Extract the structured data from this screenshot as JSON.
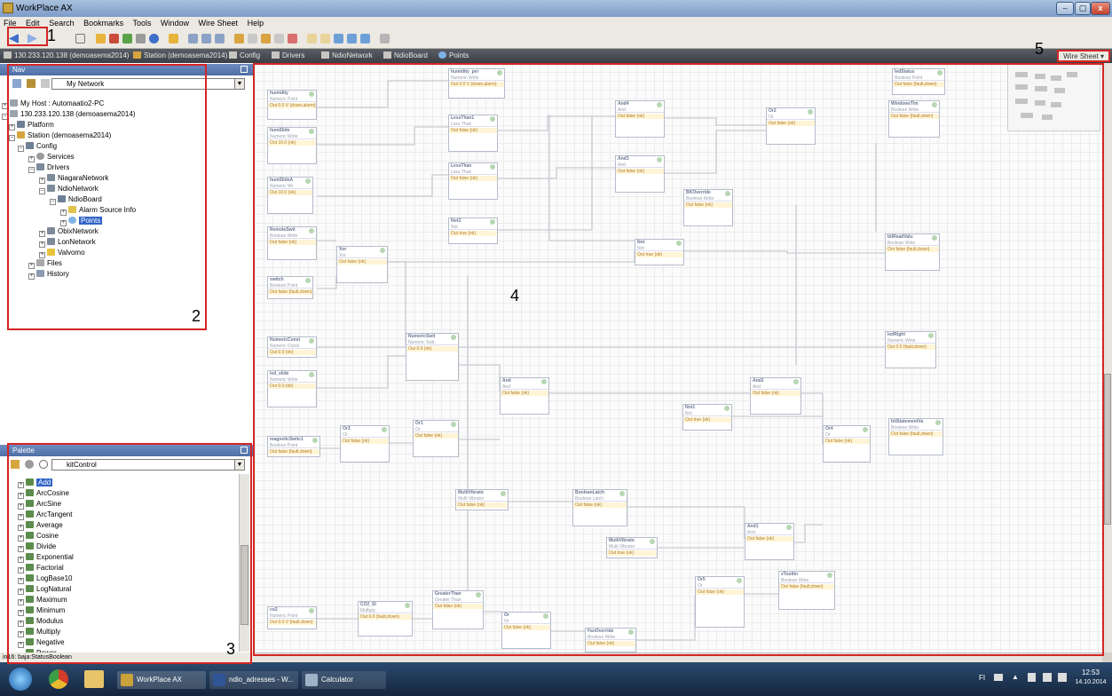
{
  "window": {
    "title": "WorkPlace AX",
    "min": "–",
    "max": "▢",
    "close": "x"
  },
  "menu": [
    "File",
    "Edit",
    "Search",
    "Bookmarks",
    "Tools",
    "Window",
    "Wire Sheet",
    "Help"
  ],
  "breadcrumb": [
    {
      "label": "130.233.120.138 (demoasema2014)",
      "icon": "host-icon"
    },
    {
      "label": "Station (demoasema2014)",
      "icon": "station-icon"
    },
    {
      "label": "Config",
      "icon": "config-icon"
    },
    {
      "label": "Drivers",
      "icon": "drivers-icon"
    },
    {
      "label": "NdioNetwork",
      "icon": "network-icon"
    },
    {
      "label": "NdioBoard",
      "icon": "board-icon"
    },
    {
      "label": "Points",
      "icon": "points-icon"
    }
  ],
  "view_selector": "Wire Sheet",
  "nav": {
    "title": "Nav",
    "selector": "My Network",
    "tree": [
      {
        "label": "My Host : Automaatio2-PC",
        "depth": 0
      },
      {
        "label": "130.233.120.138 (demoasema2014)",
        "depth": 0
      },
      {
        "label": "Platform",
        "depth": 1
      },
      {
        "label": "Station (demoasema2014)",
        "depth": 1
      },
      {
        "label": "Config",
        "depth": 2
      },
      {
        "label": "Services",
        "depth": 3
      },
      {
        "label": "Drivers",
        "depth": 3
      },
      {
        "label": "NiagaraNetwork",
        "depth": 4
      },
      {
        "label": "NdioNetwork",
        "depth": 4
      },
      {
        "label": "NdioBoard",
        "depth": 5
      },
      {
        "label": "Alarm Source Info",
        "depth": 6
      },
      {
        "label": "Points",
        "depth": 6,
        "selected": true
      },
      {
        "label": "ObixNetwork",
        "depth": 4
      },
      {
        "label": "LonNetwork",
        "depth": 4
      },
      {
        "label": "Valvomo",
        "depth": 4
      },
      {
        "label": "Files",
        "depth": 2
      },
      {
        "label": "History",
        "depth": 2
      }
    ]
  },
  "palette": {
    "title": "Palette",
    "selector": "kitControl",
    "items": [
      "Add",
      "ArcCosine",
      "ArcSine",
      "ArcTangent",
      "Average",
      "Cosine",
      "Divide",
      "Exponential",
      "Factorial",
      "LogBase10",
      "LogNatural",
      "Maximum",
      "Minimum",
      "Modulus",
      "Multiply",
      "Negative",
      "Power"
    ],
    "selected": "Add"
  },
  "status": "in16: baja:StatusBoolean",
  "callouts": [
    "1",
    "2",
    "3",
    "4",
    "5"
  ],
  "blocks": [
    {
      "name": "humidity",
      "type": "Numeric Point",
      "out": "Out 0.0 V {down,alarm}"
    },
    {
      "name": "humidity_per",
      "type": "Numeric Write",
      "out": "Out 0.0 V {down,alarm}"
    },
    {
      "name": "humSlide",
      "type": "Numeric Write",
      "out": "Out 10.0 {ok}"
    },
    {
      "name": "humSlideA",
      "type": "Numeric Wr",
      "out": "Out 10.0 {ok}"
    },
    {
      "name": "LessThan1",
      "type": "Less Than",
      "out": "Out false {ok}"
    },
    {
      "name": "LessThan",
      "type": "Less Than",
      "out": "Out false {ok}"
    },
    {
      "name": "Not3",
      "type": "Not",
      "out": "Out true {ok}"
    },
    {
      "name": "And4",
      "type": "And",
      "out": "Out false {ok}"
    },
    {
      "name": "And3",
      "type": "And",
      "out": "Out false {ok}"
    },
    {
      "name": "Or2",
      "type": "Or",
      "out": "Out false {ok}"
    },
    {
      "name": "ledStatus",
      "type": "Boolean Point",
      "out": "Out false {fault,down}"
    },
    {
      "name": "WindowsTim",
      "type": "Boolean Write",
      "out": "Out false {fault,down}"
    },
    {
      "name": "BKOverride",
      "type": "Boolean Write",
      "out": "Out false {ok}"
    },
    {
      "name": "RemoteSwit",
      "type": "Boolean Write",
      "out": "Out false {ok}"
    },
    {
      "name": "Xor",
      "type": "Xor",
      "out": "Out false {ok}"
    },
    {
      "name": "switch",
      "type": "Boolean Point",
      "out": "Out false {fault,down}"
    },
    {
      "name": "Not",
      "type": "Not",
      "out": "Out true {ok}"
    },
    {
      "name": "bitReadValu",
      "type": "Boolean Write",
      "out": "Out false {fault,down}"
    },
    {
      "name": "NumericConst",
      "type": "Numeric Const",
      "out": "Out 0.0 {ok}"
    },
    {
      "name": "NumericSwit",
      "type": "Numeric Swit.",
      "out": "Out 0.0 {ok}"
    },
    {
      "name": "ledRight",
      "type": "Numeric Write",
      "out": "Out 0.0 {fault,down}"
    },
    {
      "name": "led_slide",
      "type": "Numeric Write",
      "out": "Out 0.0 {ok}"
    },
    {
      "name": "And",
      "type": "And",
      "out": "Out false {ok}"
    },
    {
      "name": "And2",
      "type": "And",
      "out": "Out false {ok}"
    },
    {
      "name": "magneticSwitc1",
      "type": "Boolean Point",
      "out": "Out false {fault,down}"
    },
    {
      "name": "Or3",
      "type": "Or",
      "out": "Out false {ok}"
    },
    {
      "name": "Or1",
      "type": "Or",
      "out": "Out false {ok}"
    },
    {
      "name": "Not1",
      "type": "Not",
      "out": "Out true {ok}"
    },
    {
      "name": "Or4",
      "type": "Or",
      "out": "Out false {ok}"
    },
    {
      "name": "bitStatementVa",
      "type": "Boolean Write",
      "out": "Out false {fault,down}"
    },
    {
      "name": "MultiVibrato",
      "type": "Multi Vibrator",
      "out": "Out false {ok}"
    },
    {
      "name": "BooleanLatch",
      "type": "Boolean Latch",
      "out": "Out false {ok}"
    },
    {
      "name": "MultiVibrato",
      "type": "Multi Vibrator",
      "out": "Out true {ok}"
    },
    {
      "name": "And1",
      "type": "And",
      "out": "Out false {ok}"
    },
    {
      "name": "co2",
      "type": "Numeric Point",
      "out": "Out 0.0 V {fault,down}"
    },
    {
      "name": "CO2_SI",
      "type": "Multiply",
      "out": "Out 0.0 {fault,down}"
    },
    {
      "name": "GreaterThan",
      "type": "Greater Than",
      "out": "Out false {ok}"
    },
    {
      "name": "Or",
      "type": "Or",
      "out": "Out false {ok}"
    },
    {
      "name": "FanOverride",
      "type": "Boolean Write",
      "out": "Out false {ok}"
    },
    {
      "name": "Or5",
      "type": "Or",
      "out": "Out false {ok}"
    },
    {
      "name": "vTooltin",
      "type": "Boolean Write",
      "out": "Out false {fault,down}"
    }
  ],
  "taskbar": {
    "apps": [
      {
        "label": "WorkPlace AX",
        "icon": "workplace-icon"
      },
      {
        "label": "ndio_adresses - W...",
        "icon": "word-icon"
      },
      {
        "label": "Calculator",
        "icon": "calculator-icon"
      }
    ],
    "lang": "FI",
    "time": "12:53",
    "date": "14.10.2014"
  }
}
